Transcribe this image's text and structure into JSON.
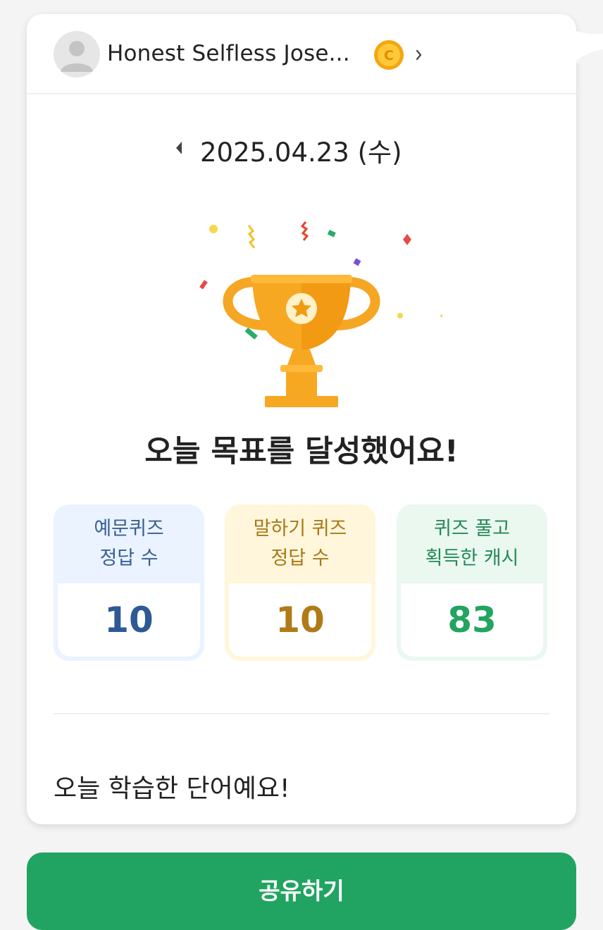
{
  "header": {
    "username": "Honest Selfless Jose...",
    "coin_icon": "coin-icon",
    "avatar_icon": "avatar-icon"
  },
  "date": {
    "text": "2025.04.23 (수)"
  },
  "goal": {
    "title": "오늘 목표를 달성했어요!"
  },
  "stats": [
    {
      "label_line1": "예문퀴즈",
      "label_line2": "정답 수",
      "value": "10"
    },
    {
      "label_line1": "말하기 퀴즈",
      "label_line2": "정답 수",
      "value": "10"
    },
    {
      "label_line1": "퀴즈 풀고",
      "label_line2": "획득한 캐시",
      "value": "83"
    }
  ],
  "words": {
    "title": "오늘 학습한 단어예요!"
  },
  "share": {
    "label": "공유하기"
  },
  "colors": {
    "accent_green": "#21a461",
    "trophy_gold": "#f7a823"
  }
}
